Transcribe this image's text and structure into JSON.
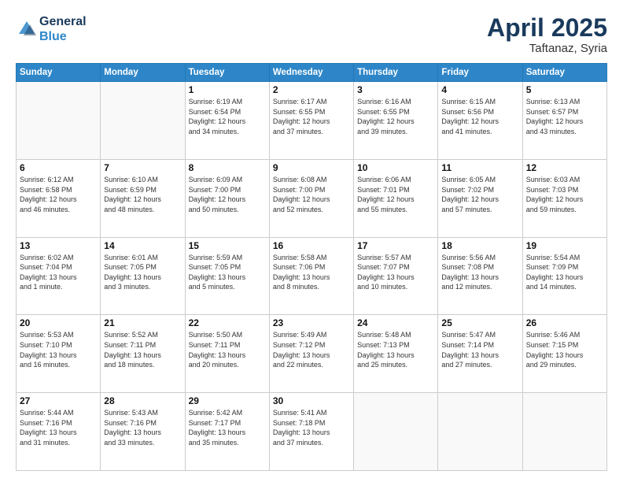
{
  "header": {
    "logo_line1": "General",
    "logo_line2": "Blue",
    "month_title": "April 2025",
    "location": "Taftanaz, Syria"
  },
  "days_of_week": [
    "Sunday",
    "Monday",
    "Tuesday",
    "Wednesday",
    "Thursday",
    "Friday",
    "Saturday"
  ],
  "weeks": [
    [
      {
        "day": "",
        "info": ""
      },
      {
        "day": "",
        "info": ""
      },
      {
        "day": "1",
        "info": "Sunrise: 6:19 AM\nSunset: 6:54 PM\nDaylight: 12 hours\nand 34 minutes."
      },
      {
        "day": "2",
        "info": "Sunrise: 6:17 AM\nSunset: 6:55 PM\nDaylight: 12 hours\nand 37 minutes."
      },
      {
        "day": "3",
        "info": "Sunrise: 6:16 AM\nSunset: 6:55 PM\nDaylight: 12 hours\nand 39 minutes."
      },
      {
        "day": "4",
        "info": "Sunrise: 6:15 AM\nSunset: 6:56 PM\nDaylight: 12 hours\nand 41 minutes."
      },
      {
        "day": "5",
        "info": "Sunrise: 6:13 AM\nSunset: 6:57 PM\nDaylight: 12 hours\nand 43 minutes."
      }
    ],
    [
      {
        "day": "6",
        "info": "Sunrise: 6:12 AM\nSunset: 6:58 PM\nDaylight: 12 hours\nand 46 minutes."
      },
      {
        "day": "7",
        "info": "Sunrise: 6:10 AM\nSunset: 6:59 PM\nDaylight: 12 hours\nand 48 minutes."
      },
      {
        "day": "8",
        "info": "Sunrise: 6:09 AM\nSunset: 7:00 PM\nDaylight: 12 hours\nand 50 minutes."
      },
      {
        "day": "9",
        "info": "Sunrise: 6:08 AM\nSunset: 7:00 PM\nDaylight: 12 hours\nand 52 minutes."
      },
      {
        "day": "10",
        "info": "Sunrise: 6:06 AM\nSunset: 7:01 PM\nDaylight: 12 hours\nand 55 minutes."
      },
      {
        "day": "11",
        "info": "Sunrise: 6:05 AM\nSunset: 7:02 PM\nDaylight: 12 hours\nand 57 minutes."
      },
      {
        "day": "12",
        "info": "Sunrise: 6:03 AM\nSunset: 7:03 PM\nDaylight: 12 hours\nand 59 minutes."
      }
    ],
    [
      {
        "day": "13",
        "info": "Sunrise: 6:02 AM\nSunset: 7:04 PM\nDaylight: 13 hours\nand 1 minute."
      },
      {
        "day": "14",
        "info": "Sunrise: 6:01 AM\nSunset: 7:05 PM\nDaylight: 13 hours\nand 3 minutes."
      },
      {
        "day": "15",
        "info": "Sunrise: 5:59 AM\nSunset: 7:05 PM\nDaylight: 13 hours\nand 5 minutes."
      },
      {
        "day": "16",
        "info": "Sunrise: 5:58 AM\nSunset: 7:06 PM\nDaylight: 13 hours\nand 8 minutes."
      },
      {
        "day": "17",
        "info": "Sunrise: 5:57 AM\nSunset: 7:07 PM\nDaylight: 13 hours\nand 10 minutes."
      },
      {
        "day": "18",
        "info": "Sunrise: 5:56 AM\nSunset: 7:08 PM\nDaylight: 13 hours\nand 12 minutes."
      },
      {
        "day": "19",
        "info": "Sunrise: 5:54 AM\nSunset: 7:09 PM\nDaylight: 13 hours\nand 14 minutes."
      }
    ],
    [
      {
        "day": "20",
        "info": "Sunrise: 5:53 AM\nSunset: 7:10 PM\nDaylight: 13 hours\nand 16 minutes."
      },
      {
        "day": "21",
        "info": "Sunrise: 5:52 AM\nSunset: 7:11 PM\nDaylight: 13 hours\nand 18 minutes."
      },
      {
        "day": "22",
        "info": "Sunrise: 5:50 AM\nSunset: 7:11 PM\nDaylight: 13 hours\nand 20 minutes."
      },
      {
        "day": "23",
        "info": "Sunrise: 5:49 AM\nSunset: 7:12 PM\nDaylight: 13 hours\nand 22 minutes."
      },
      {
        "day": "24",
        "info": "Sunrise: 5:48 AM\nSunset: 7:13 PM\nDaylight: 13 hours\nand 25 minutes."
      },
      {
        "day": "25",
        "info": "Sunrise: 5:47 AM\nSunset: 7:14 PM\nDaylight: 13 hours\nand 27 minutes."
      },
      {
        "day": "26",
        "info": "Sunrise: 5:46 AM\nSunset: 7:15 PM\nDaylight: 13 hours\nand 29 minutes."
      }
    ],
    [
      {
        "day": "27",
        "info": "Sunrise: 5:44 AM\nSunset: 7:16 PM\nDaylight: 13 hours\nand 31 minutes."
      },
      {
        "day": "28",
        "info": "Sunrise: 5:43 AM\nSunset: 7:16 PM\nDaylight: 13 hours\nand 33 minutes."
      },
      {
        "day": "29",
        "info": "Sunrise: 5:42 AM\nSunset: 7:17 PM\nDaylight: 13 hours\nand 35 minutes."
      },
      {
        "day": "30",
        "info": "Sunrise: 5:41 AM\nSunset: 7:18 PM\nDaylight: 13 hours\nand 37 minutes."
      },
      {
        "day": "",
        "info": ""
      },
      {
        "day": "",
        "info": ""
      },
      {
        "day": "",
        "info": ""
      }
    ]
  ]
}
